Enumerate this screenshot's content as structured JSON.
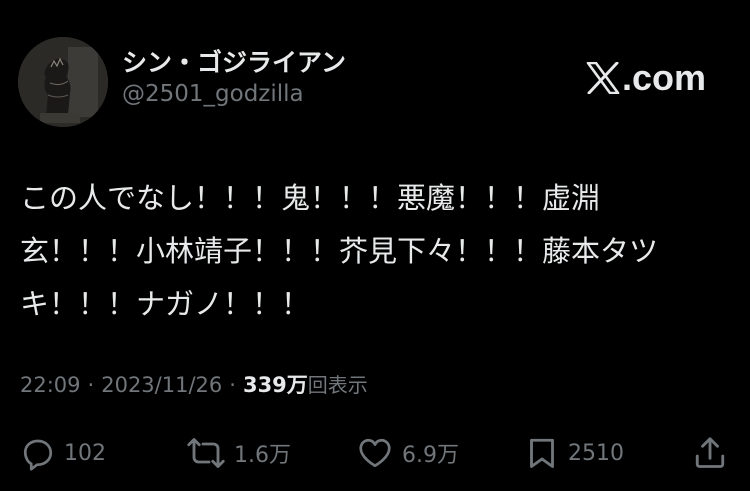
{
  "account": {
    "display_name": "シン・ゴジライアン",
    "handle": "@2501_godzilla"
  },
  "brand": {
    "label": ".com",
    "icon": "x-logo-icon"
  },
  "tweet": {
    "lines": [
      "この人でなし！！！鬼！！！悪魔！！！虚淵",
      "玄！！！小林靖子！！！芥見下々！！！藤本タツ",
      "キ！！！ナガノ！！！"
    ]
  },
  "meta": {
    "time": "22:09",
    "separator": "·",
    "date": "2023/11/26",
    "views_count": "339",
    "views_unit": "万",
    "views_label": "回表示"
  },
  "actions": {
    "replies": {
      "count": "102",
      "icon": "reply-icon"
    },
    "reposts": {
      "count": "1.6万",
      "icon": "repost-icon"
    },
    "likes": {
      "count": "6.9万",
      "icon": "heart-icon"
    },
    "bookmarks": {
      "count": "2510",
      "icon": "bookmark-icon"
    },
    "share": {
      "icon": "share-icon"
    }
  },
  "colors": {
    "background": "#000000",
    "primary_text": "#e7e9ea",
    "secondary_text": "#71767b"
  }
}
